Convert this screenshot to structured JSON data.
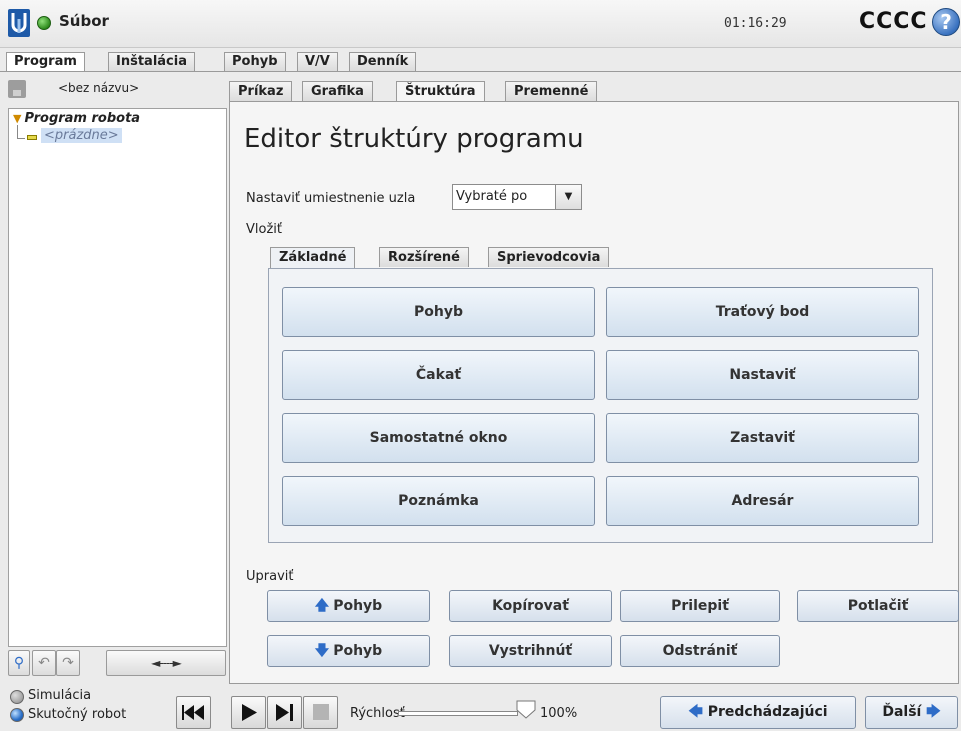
{
  "app": {
    "file_menu": "Súbor",
    "time": "01:16:29",
    "robot_name": "CCCC",
    "help_symbol": "?"
  },
  "main_tabs": [
    "Program",
    "Inštalácia",
    "Pohyb",
    "V/V",
    "Denník"
  ],
  "left": {
    "filename": "<bez názvu>",
    "tree_root": "Program robota",
    "tree_child": "<prázdne>",
    "move_arrows": "◄----►"
  },
  "sub_tabs": [
    "Príkaz",
    "Grafika",
    "Štruktúra",
    "Premenné"
  ],
  "editor": {
    "title": "Editor štruktúry programu",
    "position_label": "Nastaviť umiestnenie uzla",
    "position_value": "Vybraté po",
    "insert_label": "Vložiť",
    "insert_tabs": [
      "Základné",
      "Rozšírené",
      "Sprievodcovia"
    ],
    "insert_buttons": [
      "Pohyb",
      "Traťový bod",
      "Čakať",
      "Nastaviť",
      "Samostatné okno",
      "Zastaviť",
      "Poznámka",
      "Adresár"
    ],
    "edit_label": "Upraviť",
    "edit_buttons": {
      "move_up": "Pohyb",
      "copy": "Kopírovať",
      "paste": "Prilepiť",
      "suppress": "Potlačiť",
      "move_down": "Pohyb",
      "cut": "Vystrihnúť",
      "delete": "Odstrániť"
    }
  },
  "bottom": {
    "simulation": "Simulácia",
    "real_robot": "Skutočný robot",
    "speed_label": "Rýchlosť",
    "speed_value": "100%",
    "speed_fraction": 1.0,
    "prev": "Predchádzajúci",
    "next": "Ďalší"
  },
  "colors": {
    "accent": "#2e6cc7",
    "status_ok": "#2e8b1d"
  }
}
